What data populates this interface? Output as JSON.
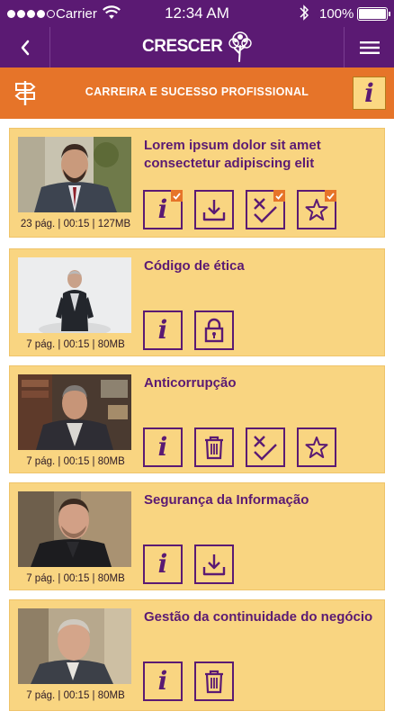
{
  "status_bar": {
    "carrier": "Carrier",
    "time": "12:34 AM",
    "battery": "100%"
  },
  "header": {
    "logo_text": "CRESCER",
    "back_icon": "chevron-left-icon",
    "menu_icon": "hamburger-menu-icon"
  },
  "section": {
    "title": "CARREIRA E SUCESSO PROFISSIONAL",
    "left_icon": "signpost-icon",
    "info_icon": "info-icon"
  },
  "colors": {
    "primary_purple": "#5b1a73",
    "orange": "#e67429",
    "card_yellow": "#f9d581"
  },
  "courses": [
    {
      "title": "Lorem ipsum dolor sit amet consectetur adipiscing elit",
      "meta": "23 pág. | 00:15 | 127MB",
      "actions": [
        {
          "icon": "info-icon",
          "checked": true
        },
        {
          "icon": "download-icon",
          "checked": false
        },
        {
          "icon": "quiz-icon",
          "checked": true
        },
        {
          "icon": "star-icon",
          "checked": true
        }
      ]
    },
    {
      "title": "Código de ética",
      "meta": "7 pág. | 00:15 | 80MB",
      "actions": [
        {
          "icon": "info-icon",
          "checked": false
        },
        {
          "icon": "lock-icon",
          "checked": false
        }
      ]
    },
    {
      "title": "Anticorrupção",
      "meta": "7 pág. | 00:15 | 80MB",
      "actions": [
        {
          "icon": "info-icon",
          "checked": false
        },
        {
          "icon": "trash-icon",
          "checked": false
        },
        {
          "icon": "quiz-icon",
          "checked": false
        },
        {
          "icon": "star-icon",
          "checked": false
        }
      ]
    },
    {
      "title": "Segurança da Informação",
      "meta": "7 pág. | 00:15 | 80MB",
      "actions": [
        {
          "icon": "info-icon",
          "checked": false
        },
        {
          "icon": "download-icon",
          "checked": false
        }
      ]
    },
    {
      "title": "Gestão da continuidade do negócio",
      "meta": "7 pág. | 00:15 | 80MB",
      "actions": [
        {
          "icon": "info-icon",
          "checked": false
        },
        {
          "icon": "trash-icon",
          "checked": false
        }
      ]
    }
  ]
}
